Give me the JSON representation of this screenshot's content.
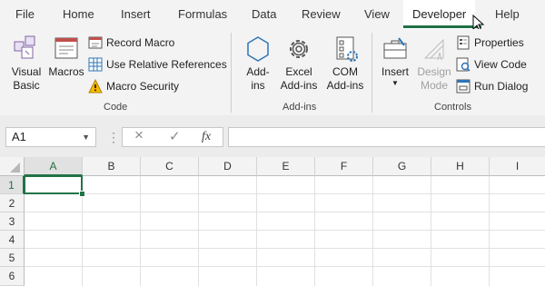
{
  "tabs": [
    "File",
    "Home",
    "Insert",
    "Formulas",
    "Data",
    "Review",
    "View",
    "Developer",
    "Help"
  ],
  "active_tab": "Developer",
  "accent_color": "#217346",
  "groups": {
    "code": {
      "label": "Code",
      "visual_basic": [
        "Visual",
        "Basic"
      ],
      "macros": "Macros",
      "record_macro": "Record Macro",
      "use_relative_references": "Use Relative References",
      "macro_security": "Macro Security"
    },
    "addins": {
      "label": "Add-ins",
      "addins": [
        "Add-",
        "ins"
      ],
      "excel_addins": [
        "Excel",
        "Add-ins"
      ],
      "com_addins": [
        "COM",
        "Add-ins"
      ]
    },
    "controls": {
      "label": "Controls",
      "insert": "Insert",
      "design_mode": [
        "Design",
        "Mode"
      ],
      "properties": "Properties",
      "view_code": "View Code",
      "run_dialog": "Run Dialog"
    }
  },
  "formula_bar": {
    "name_box": "A1",
    "fx": "fx",
    "cancel_icon": "×",
    "enter_icon": "✓",
    "formula_value": ""
  },
  "sheet": {
    "columns": [
      "A",
      "B",
      "C",
      "D",
      "E",
      "F",
      "G",
      "H",
      "I"
    ],
    "rows": [
      "1",
      "2",
      "3",
      "4",
      "5",
      "6"
    ],
    "active_cell": "A1"
  }
}
